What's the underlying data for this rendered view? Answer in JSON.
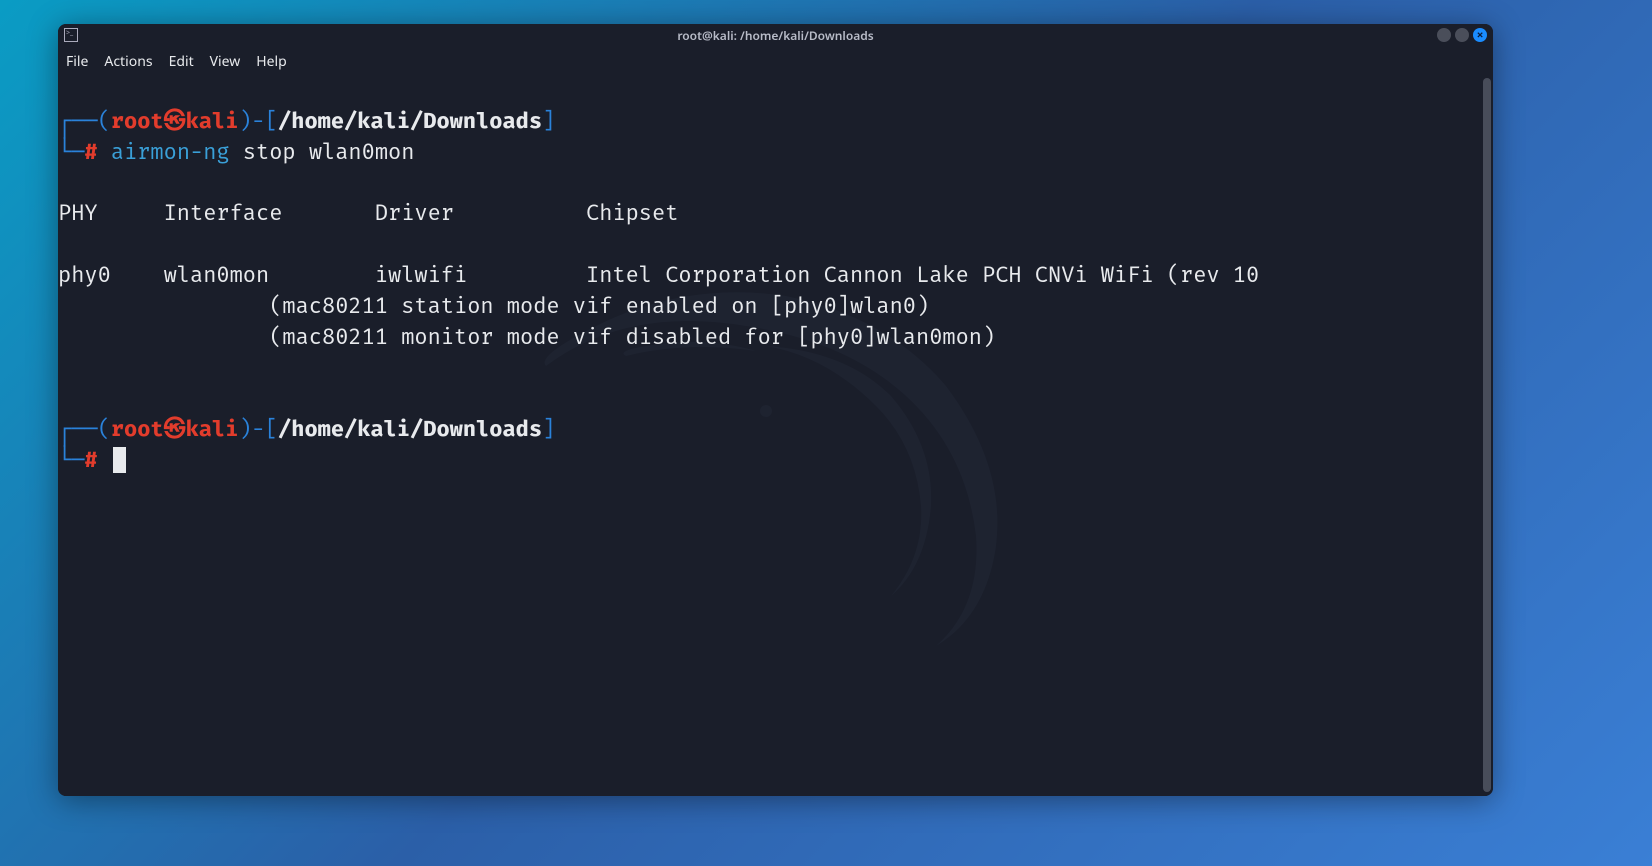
{
  "window": {
    "title": "root@kali: /home/kali/Downloads"
  },
  "menu": {
    "file": "File",
    "actions": "Actions",
    "edit": "Edit",
    "view": "View",
    "help": "Help"
  },
  "prompt": {
    "user": "root",
    "skull": "㉿",
    "host": "kali",
    "path": "/home/kali/Downloads",
    "hash": "#",
    "corner_top": "┌──",
    "corner_bot": "└─",
    "paren_open": "(",
    "paren_close": ")",
    "dash": "-",
    "bracket_open": "[",
    "bracket_close": "]"
  },
  "command1": {
    "cmd": "airmon-ng",
    "args": " stop wlan0mon"
  },
  "output": {
    "header": "PHY     Interface       Driver          Chipset",
    "row": "phy0    wlan0mon        iwlwifi         Intel Corporation Cannon Lake PCH CNVi WiFi (rev 10",
    "note1": "                (mac80211 station mode vif enabled on [phy0]wlan0)",
    "note2": "                (mac80211 monitor mode vif disabled for [phy0]wlan0mon)"
  }
}
